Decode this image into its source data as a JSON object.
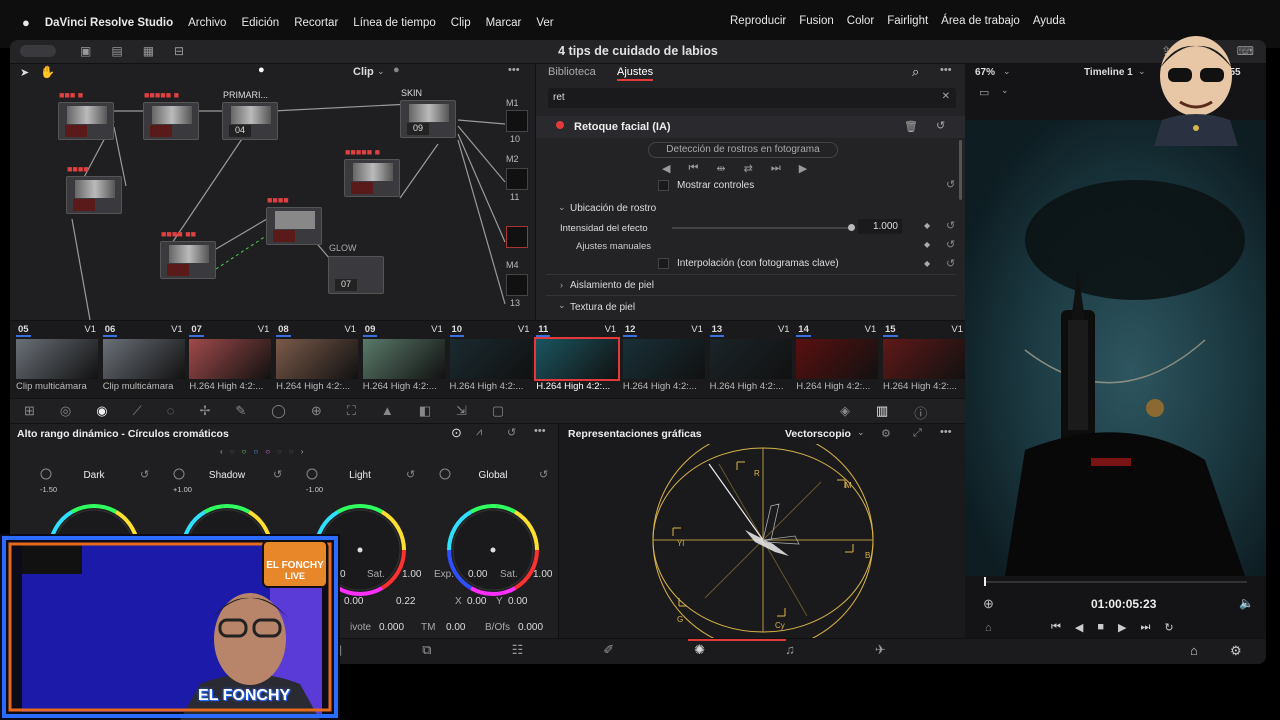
{
  "menubar": {
    "apple": "",
    "app": "DaVinci Resolve Studio",
    "items": [
      "Archivo",
      "Edición",
      "Recortar",
      "Línea de tiempo",
      "Clip",
      "Marcar",
      "Ver"
    ],
    "right_items": [
      "Reproducir",
      "Fusion",
      "Color",
      "Fairlight",
      "Área de trabajo",
      "Ayuda"
    ]
  },
  "window": {
    "title": "4 tips de cuidado de labios"
  },
  "node_editor": {
    "mode": "Clip",
    "nodes": [
      {
        "label": "",
        "num": ""
      },
      {
        "label": "",
        "num": ""
      },
      {
        "label": "PRIMARI...",
        "num": "04"
      },
      {
        "label": "SKIN",
        "num": "09"
      },
      {
        "label": "",
        "num": ""
      },
      {
        "label": "",
        "num": ""
      },
      {
        "label": "",
        "num": ""
      },
      {
        "label": "",
        "num": ""
      },
      {
        "label": "GLOW",
        "num": "07"
      }
    ],
    "outputs": [
      "M1",
      "10",
      "M2",
      "11",
      "M4",
      "13"
    ]
  },
  "adjust_panel": {
    "tabs": [
      "Biblioteca",
      "Ajustes"
    ],
    "search_value": "ret",
    "effect_name": "Retoque facial (IA)",
    "detect_button": "Detección de rostros en fotograma",
    "show_controls": "Mostrar controles",
    "section_location": "Ubicación de rostro",
    "intensity_label": "Intensidad del efecto",
    "intensity_value": "1.000",
    "manual_label": "Ajustes manuales",
    "interp_label": "Interpolación (con fotogramas clave)",
    "section_skin_iso": "Aislamiento de piel",
    "section_skin_tex": "Textura de piel"
  },
  "viewer": {
    "zoom": "67%",
    "timeline": "Timeline 1",
    "timecode_top": "54:55",
    "timecode": "01:00:05:23"
  },
  "clips": [
    {
      "n": "05",
      "track": "V1",
      "cap": "Clip multicámara"
    },
    {
      "n": "06",
      "track": "V1",
      "cap": "Clip multicámara"
    },
    {
      "n": "07",
      "track": "V1",
      "cap": "H.264 High 4:2:..."
    },
    {
      "n": "08",
      "track": "V1",
      "cap": "H.264 High 4:2:..."
    },
    {
      "n": "09",
      "track": "V1",
      "cap": "H.264 High 4:2:..."
    },
    {
      "n": "10",
      "track": "V1",
      "cap": "H.264 High 4:2:..."
    },
    {
      "n": "11",
      "track": "V1",
      "cap": "H.264 High 4:2:..."
    },
    {
      "n": "12",
      "track": "V1",
      "cap": "H.264 High 4:2:..."
    },
    {
      "n": "13",
      "track": "V1",
      "cap": "H.264 High 4:2:..."
    },
    {
      "n": "14",
      "track": "V1",
      "cap": "H.264 High 4:2:..."
    },
    {
      "n": "15",
      "track": "V1",
      "cap": "H.264 High 4:2:..."
    }
  ],
  "wheels_panel": {
    "title": "Alto rango dinámico - Círculos cromáticos",
    "wheels": [
      {
        "name": "Dark",
        "val": "-1.50"
      },
      {
        "name": "Shadow",
        "val": "+1.00"
      },
      {
        "name": "Light",
        "val": "-1.00"
      },
      {
        "name": "Global",
        "val": ""
      }
    ],
    "row1": {
      "a": "0",
      "sat_label": "Sat.",
      "sat": "1.00",
      "exp_label": "Exp.",
      "exp": "0.00",
      "sat2_label": "Sat.",
      "sat2": "1.00"
    },
    "row2": {
      "a": "0.00",
      "b": "0.22",
      "x_label": "X",
      "x": "0.00",
      "y_label": "Y",
      "y": "0.00"
    },
    "row3": {
      "pivot_label": "ivote",
      "pivot": "0.000",
      "tm_label": "TM",
      "tm": "0.00",
      "bofs_label": "B/Ofs",
      "bofs": "0.000"
    }
  },
  "scopes": {
    "title": "Representaciones gráficas",
    "mode": "Vectorscopio",
    "targets": [
      "R",
      "M",
      "B",
      "Cy",
      "G",
      "Yl"
    ]
  },
  "webcam": {
    "badge_top": "EL FONCHY",
    "badge_sub": "LIVE",
    "name": "EL FONCHY"
  },
  "colors": {
    "accent_red": "#e23a3a",
    "accent_blue": "#3b6ee0",
    "node_green": "#4ad24a",
    "node_blue": "#2ab0e0",
    "scope_gold": "#d9b44a"
  }
}
